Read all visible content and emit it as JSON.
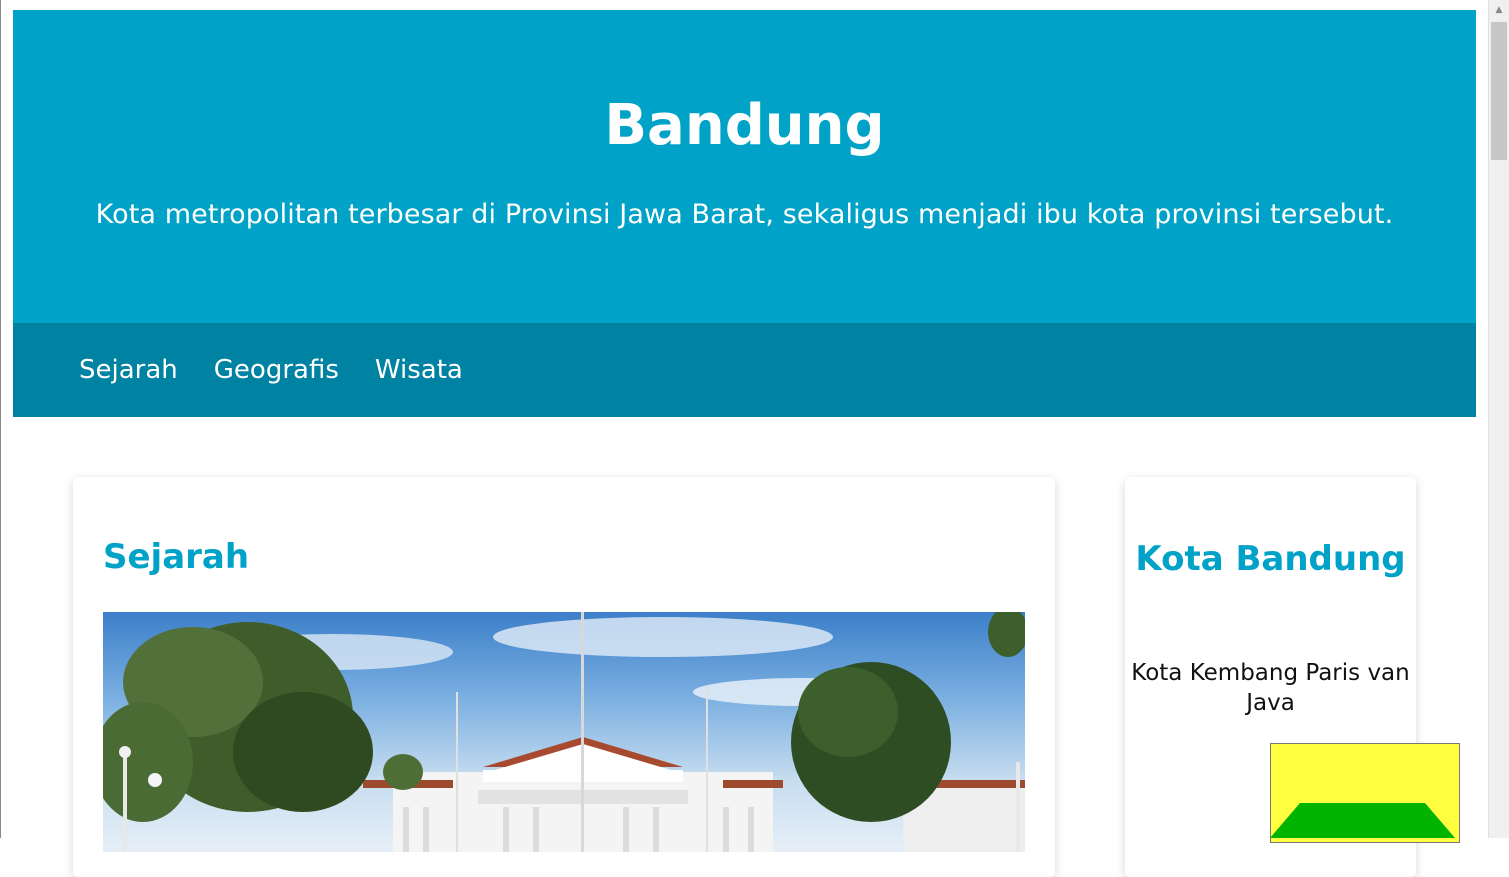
{
  "header": {
    "title": "Bandung",
    "tagline": "Kota metropolitan terbesar di Provinsi Jawa Barat, sekaligus menjadi ibu kota provinsi tersebut."
  },
  "nav": {
    "items": [
      {
        "label": "Sejarah"
      },
      {
        "label": "Geografis"
      },
      {
        "label": "Wisata"
      }
    ]
  },
  "main": {
    "section_title": "Sejarah",
    "photo_icon": "building-photo"
  },
  "aside": {
    "title": "Kota Bandung",
    "description": "Kota Kembang Paris van Java",
    "emblem_icon": "city-emblem"
  },
  "colors": {
    "header_bg": "#00a2c7",
    "nav_bg": "#0083a2",
    "accent": "#00a2c7",
    "emblem_yellow": "#ffff3f",
    "emblem_green": "#00b400"
  }
}
